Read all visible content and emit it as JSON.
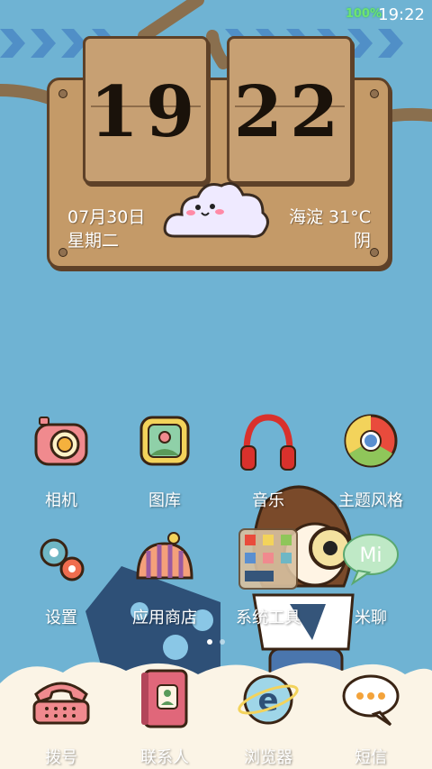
{
  "status_bar": {
    "battery": "100%",
    "time": "19:22"
  },
  "clock_widget": {
    "hour": "19",
    "minute": "22",
    "date": "07月30日",
    "weekday": "星期二",
    "location_temp": "海淀 31°C",
    "weather": "阴"
  },
  "apps": [
    {
      "label": "相机",
      "icon": "camera-icon"
    },
    {
      "label": "图库",
      "icon": "gallery-icon"
    },
    {
      "label": "音乐",
      "icon": "headphones-icon"
    },
    {
      "label": "主题风格",
      "icon": "theme-icon"
    },
    {
      "label": "设置",
      "icon": "gear-icon"
    },
    {
      "label": "应用商店",
      "icon": "store-icon"
    },
    {
      "label": "系统工具",
      "icon": "tools-folder-icon"
    },
    {
      "label": "米聊",
      "icon": "mitalk-icon"
    }
  ],
  "dock": [
    {
      "label": "拨号",
      "icon": "phone-icon"
    },
    {
      "label": "联系人",
      "icon": "contacts-icon"
    },
    {
      "label": "浏览器",
      "icon": "browser-icon"
    },
    {
      "label": "短信",
      "icon": "message-icon"
    }
  ],
  "page_indicator": {
    "pages": 2,
    "current": 1
  },
  "colors": {
    "background": "#6fb3d3",
    "board": "#c49a68",
    "board_border": "#5e4128",
    "label_text": "#ffffff",
    "battery_text": "#6fe36f"
  }
}
